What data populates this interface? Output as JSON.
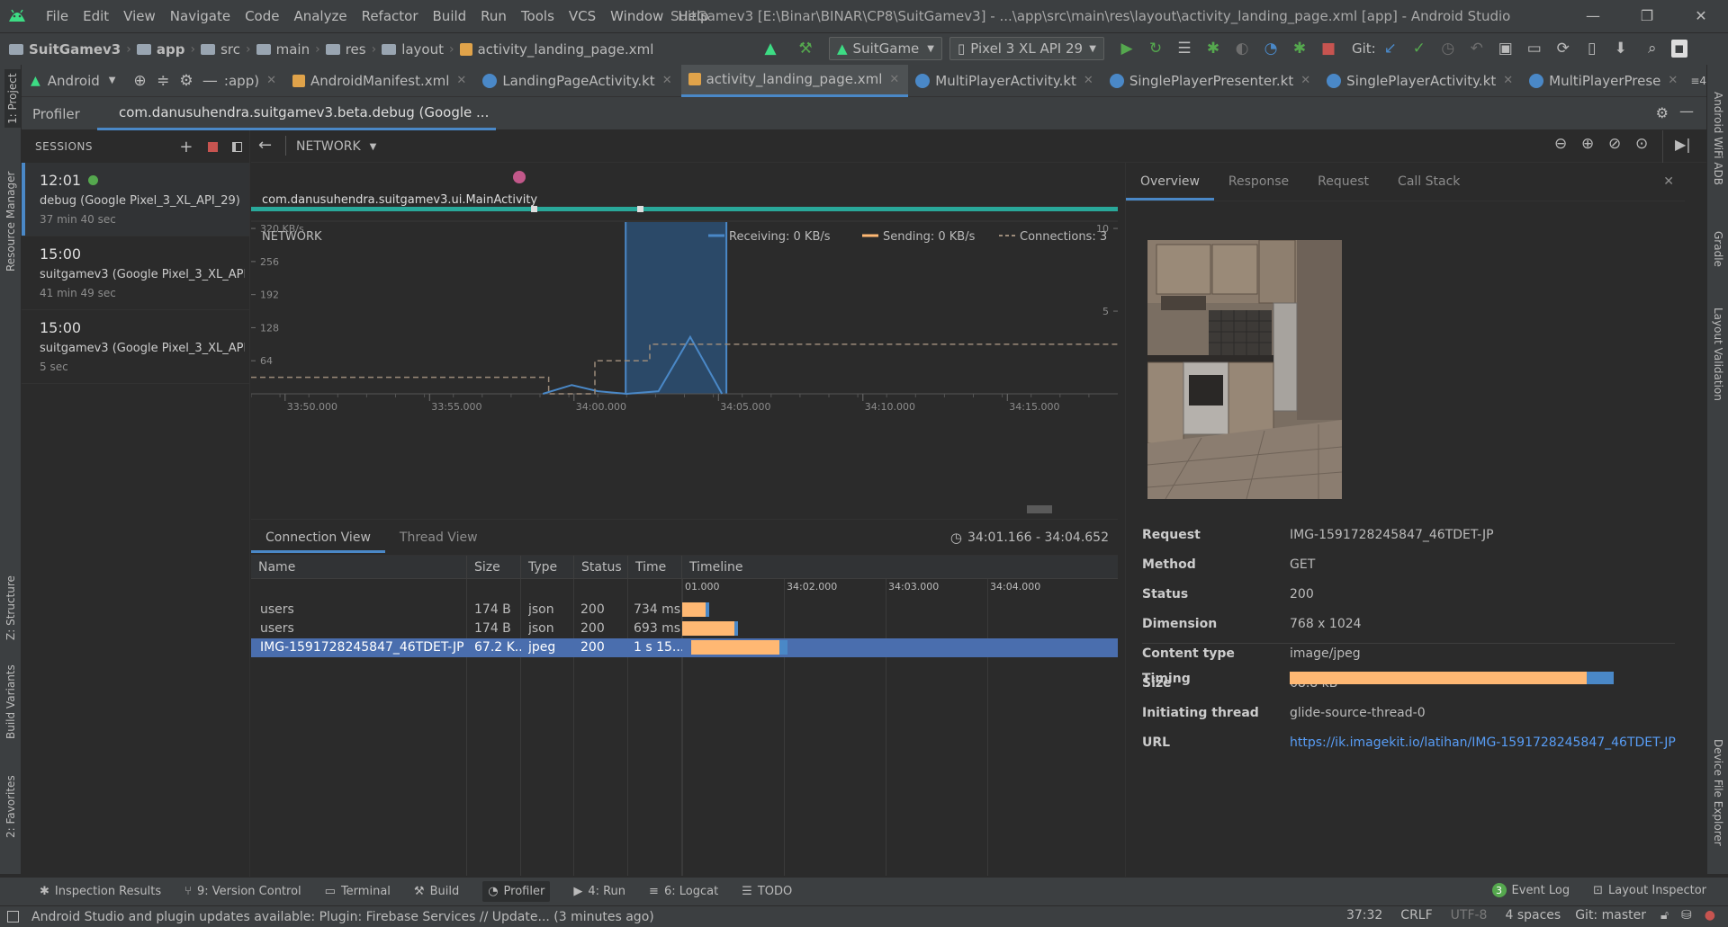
{
  "app": {
    "title": "SuitGamev3 [E:\\Binar\\BINAR\\CP8\\SuitGamev3] - ...\\app\\src\\main\\res\\layout\\activity_landing_page.xml [app] - Android Studio",
    "menu": [
      "File",
      "Edit",
      "View",
      "Navigate",
      "Code",
      "Analyze",
      "Refactor",
      "Build",
      "Run",
      "Tools",
      "VCS",
      "Window",
      "Help"
    ],
    "window_controls": [
      "—",
      "❐",
      "✕"
    ]
  },
  "breadcrumb": [
    "SuitGamev3",
    "app",
    "src",
    "main",
    "res",
    "layout",
    "activity_landing_page.xml"
  ],
  "toolbar": {
    "run_config": "SuitGame",
    "device": "Pixel 3 XL API 29",
    "git_label": "Git:"
  },
  "editor_tabs": {
    "project_view": "Android",
    "partial_tab": ":app)",
    "tabs": [
      "AndroidManifest.xml",
      "LandingPageActivity.kt",
      "activity_landing_page.xml",
      "MultiPlayerActivity.kt",
      "SinglePlayerPresenter.kt",
      "SinglePlayerActivity.kt",
      "MultiPlayerPrese"
    ],
    "overflow": "≡4"
  },
  "left_tools": [
    "1: Project",
    "Resource Manager",
    "Z: Structure",
    "Build Variants",
    "2: Favorites"
  ],
  "right_tools": [
    "Android WiFi ADB",
    "Gradle",
    "Layout Validation",
    "Device File Explorer"
  ],
  "profiler": {
    "title": "Profiler",
    "process": "com.danusuhendra.suitgamev3.beta.debug (Google ..."
  },
  "sessions": {
    "header": "SESSIONS",
    "items": [
      {
        "time": "12:01",
        "name": "debug (Google Pixel_3_XL_API_29)",
        "duration": "37 min 40 sec",
        "live": true
      },
      {
        "time": "15:00",
        "name": "suitgamev3 (Google Pixel_3_XL_API_...",
        "duration": "41 min 49 sec",
        "live": false
      },
      {
        "time": "15:00",
        "name": "suitgamev3 (Google Pixel_3_XL_API_...",
        "duration": "5 sec",
        "live": false
      }
    ]
  },
  "network": {
    "dropdown": "NETWORK",
    "activity": "com.danusuhendra.suitgamev3.ui.MainActivity",
    "label": "NETWORK",
    "legend": {
      "receiving": "Receiving: 0 KB/s",
      "sending": "Sending: 0 KB/s",
      "connections": "Connections: 3"
    },
    "colors": {
      "receiving": "#4a88c7",
      "sending": "#ffb873",
      "connections": "#9c8b7a",
      "selection": "#2b4d6f",
      "activity_bar": "#29a89a"
    }
  },
  "chart_data": {
    "type": "line",
    "x_ticks": [
      "33:50.000",
      "33:55.000",
      "34:00.000",
      "34:05.000",
      "34:10.000",
      "34:15.000"
    ],
    "y_ticks_left": [
      "320 KB/s",
      "256",
      "192",
      "128",
      "64"
    ],
    "y_ticks_right": [
      "10",
      "5"
    ],
    "x_range": [
      "33:48.200",
      "34:18.200"
    ],
    "ylim": [
      0,
      320
    ],
    "ylim_right": [
      0,
      10
    ],
    "selection": [
      "34:01.166",
      "34:04.652"
    ],
    "series": [
      {
        "name": "Receiving",
        "x": [
          "33:58.300",
          "33:59.300",
          "34:00.200",
          "34:01.200",
          "34:02.300",
          "34:03.400",
          "34:04.500"
        ],
        "values": [
          0,
          17,
          5,
          0,
          5,
          110,
          0
        ]
      },
      {
        "name": "Connections",
        "x": [
          "33:48.200",
          "33:58.000",
          "33:58.500",
          "34:00.100",
          "34:01.100",
          "34:02.000",
          "34:18.200"
        ],
        "values": [
          1,
          1,
          0,
          2,
          2,
          3,
          3
        ]
      }
    ]
  },
  "connection_view": {
    "tabs": [
      "Connection View",
      "Thread View"
    ],
    "range": "34:01.166 - 34:04.652",
    "columns": [
      "Name",
      "Size",
      "Type",
      "Status",
      "Time",
      "Timeline"
    ],
    "timeline_ticks": [
      "01.000",
      "34:02.000",
      "34:03.000",
      "34:04.000"
    ],
    "rows": [
      {
        "name": "users",
        "size": "174 B",
        "type": "json",
        "status": "200",
        "time": "734 ms",
        "send_start": 0.0,
        "send_end": 0.27,
        "recv_end": 0.32
      },
      {
        "name": "users",
        "size": "174 B",
        "type": "json",
        "status": "200",
        "time": "693 ms",
        "send_start": 0.0,
        "send_end": 0.61,
        "recv_end": 0.66
      },
      {
        "name": "IMG-1591728245847_46TDET-JP",
        "size": "67.2 K...",
        "type": "jpeg",
        "status": "200",
        "time": "1 s 15...",
        "send_start": 0.36,
        "send_end": 1.4,
        "recv_end": 1.5,
        "selected": true
      }
    ]
  },
  "details": {
    "tabs": [
      "Overview",
      "Response",
      "Request",
      "Call Stack"
    ],
    "fields": [
      {
        "label": "Request",
        "value": "IMG-1591728245847_46TDET-JP"
      },
      {
        "label": "Method",
        "value": "GET"
      },
      {
        "label": "Status",
        "value": "200"
      },
      {
        "label": "Dimension",
        "value": "768 x 1024"
      },
      {
        "label": "Content type",
        "value": "image/jpeg"
      },
      {
        "label": "Size",
        "value": "68.8 kB"
      },
      {
        "label": "Initiating thread",
        "value": "glide-source-thread-0"
      },
      {
        "label": "URL",
        "value": "https://ik.imagekit.io/latihan/IMG-1591728245847_46TDET-JP"
      }
    ],
    "timing_label": "Timing",
    "timing": {
      "send_fraction": 0.918,
      "receive_fraction": 0.082
    }
  },
  "bottom_tools": {
    "left": [
      "Inspection Results",
      "9: Version Control",
      "Terminal",
      "Build",
      "Profiler",
      "4: Run",
      "6: Logcat",
      "TODO"
    ],
    "right": [
      "Event Log",
      "Layout Inspector"
    ],
    "event_count": "3"
  },
  "status": {
    "message": "Android Studio and plugin updates available: Plugin: Firebase Services // Update... (3 minutes ago)",
    "position": "37:32",
    "line_sep": "CRLF",
    "encoding": "UTF-8",
    "indent": "4 spaces",
    "git": "Git: master"
  }
}
